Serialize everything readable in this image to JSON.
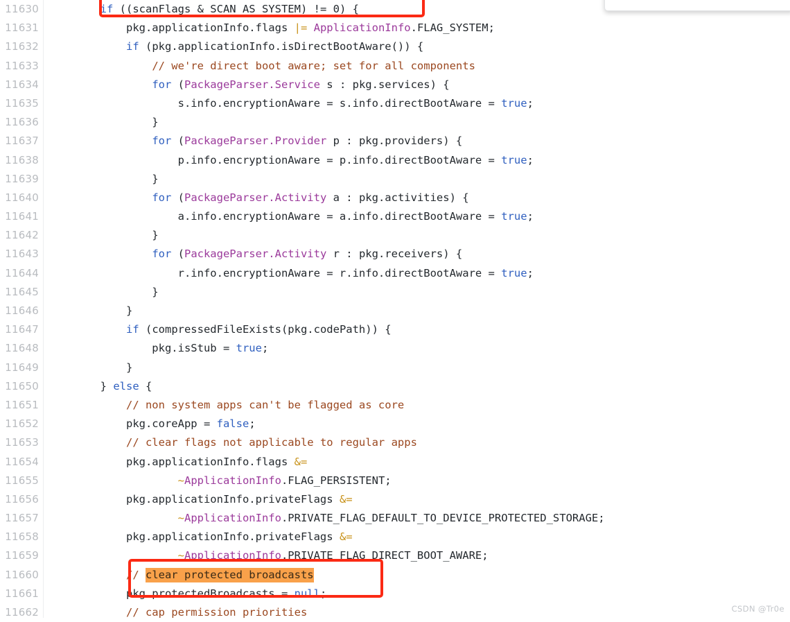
{
  "viewer": {
    "language": "java",
    "first_line_number": 11630,
    "last_line_number": 11662,
    "gutter_color": "#b9bcc0",
    "background_color": "#ffffff"
  },
  "theme": {
    "keyword_color": "#2f5fbf",
    "type_color": "#9b3a9b",
    "comment_color": "#9b4820",
    "operator_color": "#c8921a",
    "plain_color": "#24292e",
    "annotation_box_color": "#fb2a14",
    "highlight_color": "#f9a14a"
  },
  "watermark": {
    "text": "CSDN @Tr0e"
  },
  "annotations": [
    {
      "name": "red-box-top",
      "shape": "rectangle",
      "color": "#fb2a14",
      "targets_line": 11630
    },
    {
      "name": "red-box-bottom",
      "shape": "rectangle",
      "color": "#fb2a14",
      "targets_lines": [
        11660,
        11661
      ]
    },
    {
      "name": "orange-text-highlight",
      "shape": "text-highlight",
      "color": "#f9a14a",
      "text": "clear protected broadcasts",
      "targets_line": 11660
    }
  ],
  "lines": [
    {
      "no": "11630",
      "tokens": [
        {
          "t": "        ",
          "c": "plain"
        },
        {
          "t": "if",
          "c": "kw"
        },
        {
          "t": " ((scanFlags & SCAN_AS_SYSTEM) != 0) {",
          "c": "plain"
        }
      ]
    },
    {
      "no": "11631",
      "tokens": [
        {
          "t": "            pkg.applicationInfo.flags ",
          "c": "plain"
        },
        {
          "t": "|=",
          "c": "op"
        },
        {
          "t": " ",
          "c": "plain"
        },
        {
          "t": "ApplicationInfo",
          "c": "type"
        },
        {
          "t": ".FLAG_SYSTEM;",
          "c": "plain"
        }
      ]
    },
    {
      "no": "11632",
      "tokens": [
        {
          "t": "            ",
          "c": "plain"
        },
        {
          "t": "if",
          "c": "kw"
        },
        {
          "t": " (pkg.applicationInfo.isDirectBootAware()) {",
          "c": "plain"
        }
      ]
    },
    {
      "no": "11633",
      "tokens": [
        {
          "t": "                ",
          "c": "plain"
        },
        {
          "t": "// we're direct boot aware; set for all components",
          "c": "comment"
        }
      ]
    },
    {
      "no": "11634",
      "tokens": [
        {
          "t": "                ",
          "c": "plain"
        },
        {
          "t": "for",
          "c": "kw"
        },
        {
          "t": " (",
          "c": "plain"
        },
        {
          "t": "PackageParser.Service",
          "c": "type"
        },
        {
          "t": " s : pkg.services) {",
          "c": "plain"
        }
      ]
    },
    {
      "no": "11635",
      "tokens": [
        {
          "t": "                    s.info.encryptionAware = s.info.directBootAware = ",
          "c": "plain"
        },
        {
          "t": "true",
          "c": "kw"
        },
        {
          "t": ";",
          "c": "plain"
        }
      ]
    },
    {
      "no": "11636",
      "tokens": [
        {
          "t": "                }",
          "c": "plain"
        }
      ]
    },
    {
      "no": "11637",
      "tokens": [
        {
          "t": "                ",
          "c": "plain"
        },
        {
          "t": "for",
          "c": "kw"
        },
        {
          "t": " (",
          "c": "plain"
        },
        {
          "t": "PackageParser.Provider",
          "c": "type"
        },
        {
          "t": " p : pkg.providers) {",
          "c": "plain"
        }
      ]
    },
    {
      "no": "11638",
      "tokens": [
        {
          "t": "                    p.info.encryptionAware = p.info.directBootAware = ",
          "c": "plain"
        },
        {
          "t": "true",
          "c": "kw"
        },
        {
          "t": ";",
          "c": "plain"
        }
      ]
    },
    {
      "no": "11639",
      "tokens": [
        {
          "t": "                }",
          "c": "plain"
        }
      ]
    },
    {
      "no": "11640",
      "tokens": [
        {
          "t": "                ",
          "c": "plain"
        },
        {
          "t": "for",
          "c": "kw"
        },
        {
          "t": " (",
          "c": "plain"
        },
        {
          "t": "PackageParser.Activity",
          "c": "type"
        },
        {
          "t": " a : pkg.activities) {",
          "c": "plain"
        }
      ]
    },
    {
      "no": "11641",
      "tokens": [
        {
          "t": "                    a.info.encryptionAware = a.info.directBootAware = ",
          "c": "plain"
        },
        {
          "t": "true",
          "c": "kw"
        },
        {
          "t": ";",
          "c": "plain"
        }
      ]
    },
    {
      "no": "11642",
      "tokens": [
        {
          "t": "                }",
          "c": "plain"
        }
      ]
    },
    {
      "no": "11643",
      "tokens": [
        {
          "t": "                ",
          "c": "plain"
        },
        {
          "t": "for",
          "c": "kw"
        },
        {
          "t": " (",
          "c": "plain"
        },
        {
          "t": "PackageParser.Activity",
          "c": "type"
        },
        {
          "t": " r : pkg.receivers) {",
          "c": "plain"
        }
      ]
    },
    {
      "no": "11644",
      "tokens": [
        {
          "t": "                    r.info.encryptionAware = r.info.directBootAware = ",
          "c": "plain"
        },
        {
          "t": "true",
          "c": "kw"
        },
        {
          "t": ";",
          "c": "plain"
        }
      ]
    },
    {
      "no": "11645",
      "tokens": [
        {
          "t": "                }",
          "c": "plain"
        }
      ]
    },
    {
      "no": "11646",
      "tokens": [
        {
          "t": "            }",
          "c": "plain"
        }
      ]
    },
    {
      "no": "11647",
      "tokens": [
        {
          "t": "            ",
          "c": "plain"
        },
        {
          "t": "if",
          "c": "kw"
        },
        {
          "t": " (compressedFileExists(pkg.codePath)) {",
          "c": "plain"
        }
      ]
    },
    {
      "no": "11648",
      "tokens": [
        {
          "t": "                pkg.isStub = ",
          "c": "plain"
        },
        {
          "t": "true",
          "c": "kw"
        },
        {
          "t": ";",
          "c": "plain"
        }
      ]
    },
    {
      "no": "11649",
      "tokens": [
        {
          "t": "            }",
          "c": "plain"
        }
      ]
    },
    {
      "no": "11650",
      "tokens": [
        {
          "t": "        } ",
          "c": "plain"
        },
        {
          "t": "else",
          "c": "kw"
        },
        {
          "t": " {",
          "c": "plain"
        }
      ]
    },
    {
      "no": "11651",
      "tokens": [
        {
          "t": "            ",
          "c": "plain"
        },
        {
          "t": "// non system apps can't be flagged as core",
          "c": "comment"
        }
      ]
    },
    {
      "no": "11652",
      "tokens": [
        {
          "t": "            pkg.coreApp = ",
          "c": "plain"
        },
        {
          "t": "false",
          "c": "kw"
        },
        {
          "t": ";",
          "c": "plain"
        }
      ]
    },
    {
      "no": "11653",
      "tokens": [
        {
          "t": "            ",
          "c": "plain"
        },
        {
          "t": "// clear flags not applicable to regular apps",
          "c": "comment"
        }
      ]
    },
    {
      "no": "11654",
      "tokens": [
        {
          "t": "            pkg.applicationInfo.flags ",
          "c": "plain"
        },
        {
          "t": "&=",
          "c": "op"
        }
      ]
    },
    {
      "no": "11655",
      "tokens": [
        {
          "t": "                    ",
          "c": "plain"
        },
        {
          "t": "~",
          "c": "op"
        },
        {
          "t": "ApplicationInfo",
          "c": "type"
        },
        {
          "t": ".FLAG_PERSISTENT;",
          "c": "plain"
        }
      ]
    },
    {
      "no": "11656",
      "tokens": [
        {
          "t": "            pkg.applicationInfo.privateFlags ",
          "c": "plain"
        },
        {
          "t": "&=",
          "c": "op"
        }
      ]
    },
    {
      "no": "11657",
      "tokens": [
        {
          "t": "                    ",
          "c": "plain"
        },
        {
          "t": "~",
          "c": "op"
        },
        {
          "t": "ApplicationInfo",
          "c": "type"
        },
        {
          "t": ".PRIVATE_FLAG_DEFAULT_TO_DEVICE_PROTECTED_STORAGE;",
          "c": "plain"
        }
      ]
    },
    {
      "no": "11658",
      "tokens": [
        {
          "t": "            pkg.applicationInfo.privateFlags ",
          "c": "plain"
        },
        {
          "t": "&=",
          "c": "op"
        }
      ]
    },
    {
      "no": "11659",
      "tokens": [
        {
          "t": "                    ",
          "c": "plain"
        },
        {
          "t": "~",
          "c": "op"
        },
        {
          "t": "ApplicationInfo",
          "c": "type"
        },
        {
          "t": ".PRIVATE_FLAG_DIRECT_BOOT_AWARE;",
          "c": "plain"
        }
      ]
    },
    {
      "no": "11660",
      "tokens": [
        {
          "t": "            ",
          "c": "plain"
        },
        {
          "t": "// ",
          "c": "comment"
        },
        {
          "t": "clear protected broadcasts",
          "c": "comment-hl"
        }
      ]
    },
    {
      "no": "11661",
      "tokens": [
        {
          "t": "            pkg.protectedBroadcasts = ",
          "c": "plain"
        },
        {
          "t": "null",
          "c": "kw"
        },
        {
          "t": ";",
          "c": "plain"
        }
      ]
    },
    {
      "no": "11662",
      "tokens": [
        {
          "t": "            ",
          "c": "plain"
        },
        {
          "t": "// cap permission priorities",
          "c": "comment"
        }
      ]
    }
  ]
}
